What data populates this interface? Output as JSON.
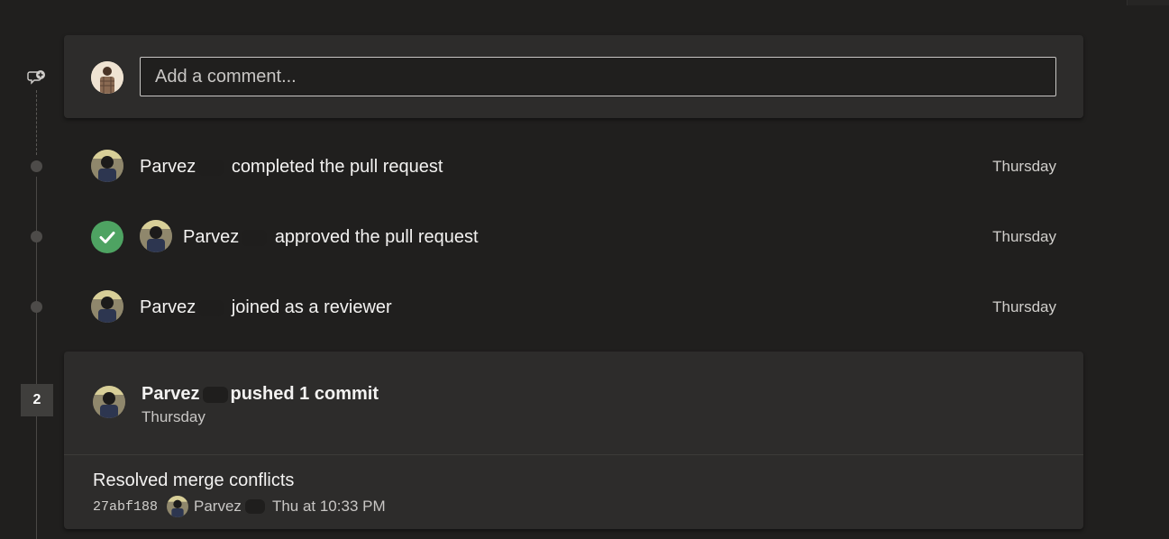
{
  "comment_box": {
    "placeholder": "Add a comment..."
  },
  "activities": [
    {
      "author": "Parvez",
      "action": "completed the pull request",
      "time": "Thursday",
      "icon": "none"
    },
    {
      "author": "Parvez",
      "action": "approved the pull request",
      "time": "Thursday",
      "icon": "checkmark-icon"
    },
    {
      "author": "Parvez",
      "action": "joined as a reviewer",
      "time": "Thursday",
      "icon": "none"
    }
  ],
  "push": {
    "badge": "2",
    "author": "Parvez",
    "action": "pushed 1 commit",
    "time": "Thursday",
    "commit": {
      "message": "Resolved merge conflicts",
      "hash": "27abf188",
      "author": "Parvez",
      "date": "Thu at 10:33 PM"
    }
  },
  "colors": {
    "background": "#201f1e",
    "card": "#2d2c2b",
    "approve_green": "#4ea362",
    "text_primary": "#f3f2f1",
    "text_secondary": "#c8c6c4"
  }
}
